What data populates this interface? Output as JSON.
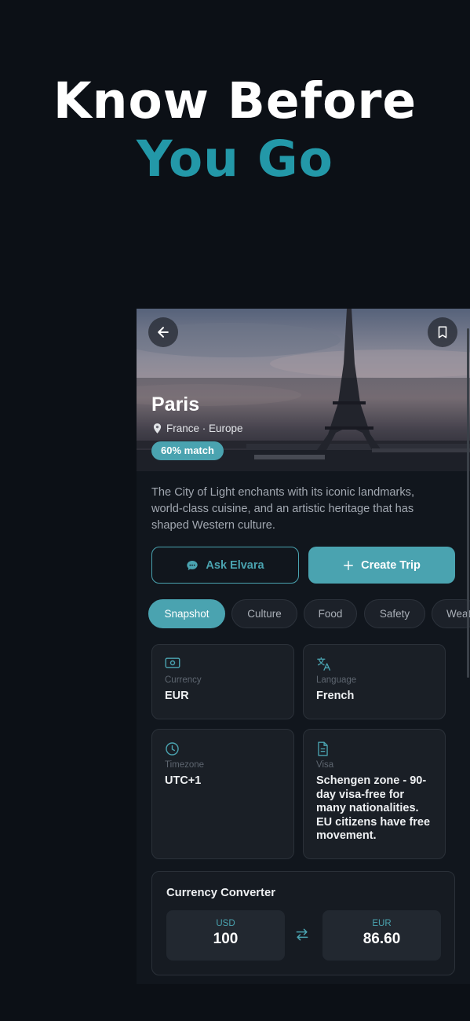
{
  "headline": {
    "line1": "Know Before",
    "line2": "You Go"
  },
  "destination": {
    "name": "Paris",
    "location": "France · Europe",
    "match": "60% match",
    "description": "The City of Light enchants with its iconic landmarks, world-class cuisine, and an artistic heritage that has shaped Western culture."
  },
  "actions": {
    "ask": "Ask Elvara",
    "create": "Create Trip"
  },
  "tabs": [
    {
      "label": "Snapshot",
      "active": true
    },
    {
      "label": "Culture",
      "active": false
    },
    {
      "label": "Food",
      "active": false
    },
    {
      "label": "Safety",
      "active": false
    },
    {
      "label": "Weat",
      "active": false
    }
  ],
  "snapshot": {
    "currency": {
      "label": "Currency",
      "value": "EUR",
      "icon": "banknote-icon"
    },
    "language": {
      "label": "Language",
      "value": "French",
      "icon": "translate-icon"
    },
    "timezone": {
      "label": "Timezone",
      "value": "UTC+1",
      "icon": "clock-icon"
    },
    "visa": {
      "label": "Visa",
      "value": "Schengen zone - 90-day visa-free for many nationalities. EU citizens have free movement.",
      "icon": "document-icon"
    }
  },
  "converter": {
    "title": "Currency Converter",
    "from": {
      "currency": "USD",
      "amount": "100"
    },
    "to": {
      "currency": "EUR",
      "amount": "86.60"
    }
  },
  "colors": {
    "accent": "#4aa3b0",
    "headline_accent": "#2398a8",
    "background": "#0c1016"
  }
}
